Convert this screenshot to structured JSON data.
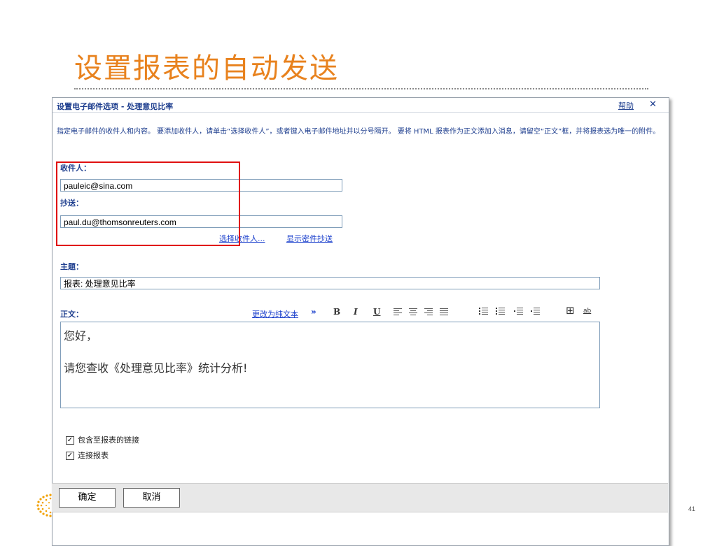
{
  "slide": {
    "title": "设置报表的自动发送",
    "page_number": "41"
  },
  "dialog": {
    "title": "设置电子邮件选项 - 处理意见比率",
    "help_link": "帮助",
    "close_glyph": "✕",
    "instructions": "指定电子邮件的收件人和内容。 要添加收件人，请单击“选择收件人”，或者键入电子邮件地址并以分号隔开。 要将 HTML 报表作为正文添加入消息，请留空“正文”框，并将报表选为唯一的附件。",
    "to_label": "收件人：",
    "to_value": "pauleic@sina.com",
    "cc_label": "抄送：",
    "cc_value": "paul.du@thomsonreuters.com",
    "select_recipients_link": "选择收件人...",
    "show_bcc_link": "显示密件抄送",
    "subject_label": "主题：",
    "subject_value": "报表: 处理意见比率",
    "body_label": "正文：",
    "plain_text_link": "更改为纯文本",
    "plain_text_arrow": "»",
    "toolbar": {
      "bold": "B",
      "italic": "I",
      "underline": "U",
      "table_glyph": "⊞",
      "spell_glyph": "ab"
    },
    "body_lines": [
      "您好，",
      "请您查收《处理意见比率》统计分析!"
    ],
    "checkbox_link": {
      "label": "包含至报表的链接",
      "checked": true
    },
    "checkbox_attach": {
      "label": "连接报表",
      "checked": true
    },
    "check_glyph": "✓",
    "ok_button": "确定",
    "cancel_button": "取消"
  },
  "colors": {
    "title_orange": "#e8821e",
    "label_blue": "#1f3f8f",
    "link_blue": "#1a3fcc",
    "highlight_red": "#e01010"
  }
}
